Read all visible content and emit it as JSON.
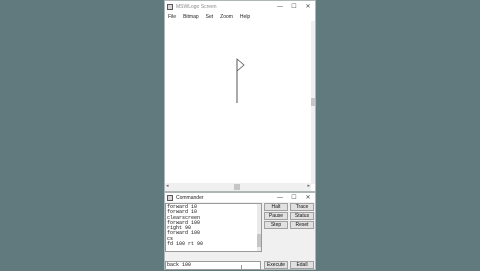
{
  "screen_window": {
    "title": "MSWLogo Screen",
    "min": "—",
    "max": "☐",
    "close": "✕",
    "menu": [
      "File",
      "Bitmap",
      "Set",
      "Zoom",
      "Help"
    ]
  },
  "commander_window": {
    "title": "Commander",
    "min": "—",
    "max": "☐",
    "close": "✕",
    "history": "forward 10\nforward 10\nclearscreen\nforward 100\nright 90\nforward 100\ncs\nfd 100 rt 90",
    "buttons": {
      "halt": "Halt",
      "trace": "Trace",
      "pause": "Pause",
      "status": "Status",
      "step": "Step",
      "reset": "Reset",
      "execute": "Execute",
      "edall": "Edall"
    },
    "input_value": "back 100"
  }
}
